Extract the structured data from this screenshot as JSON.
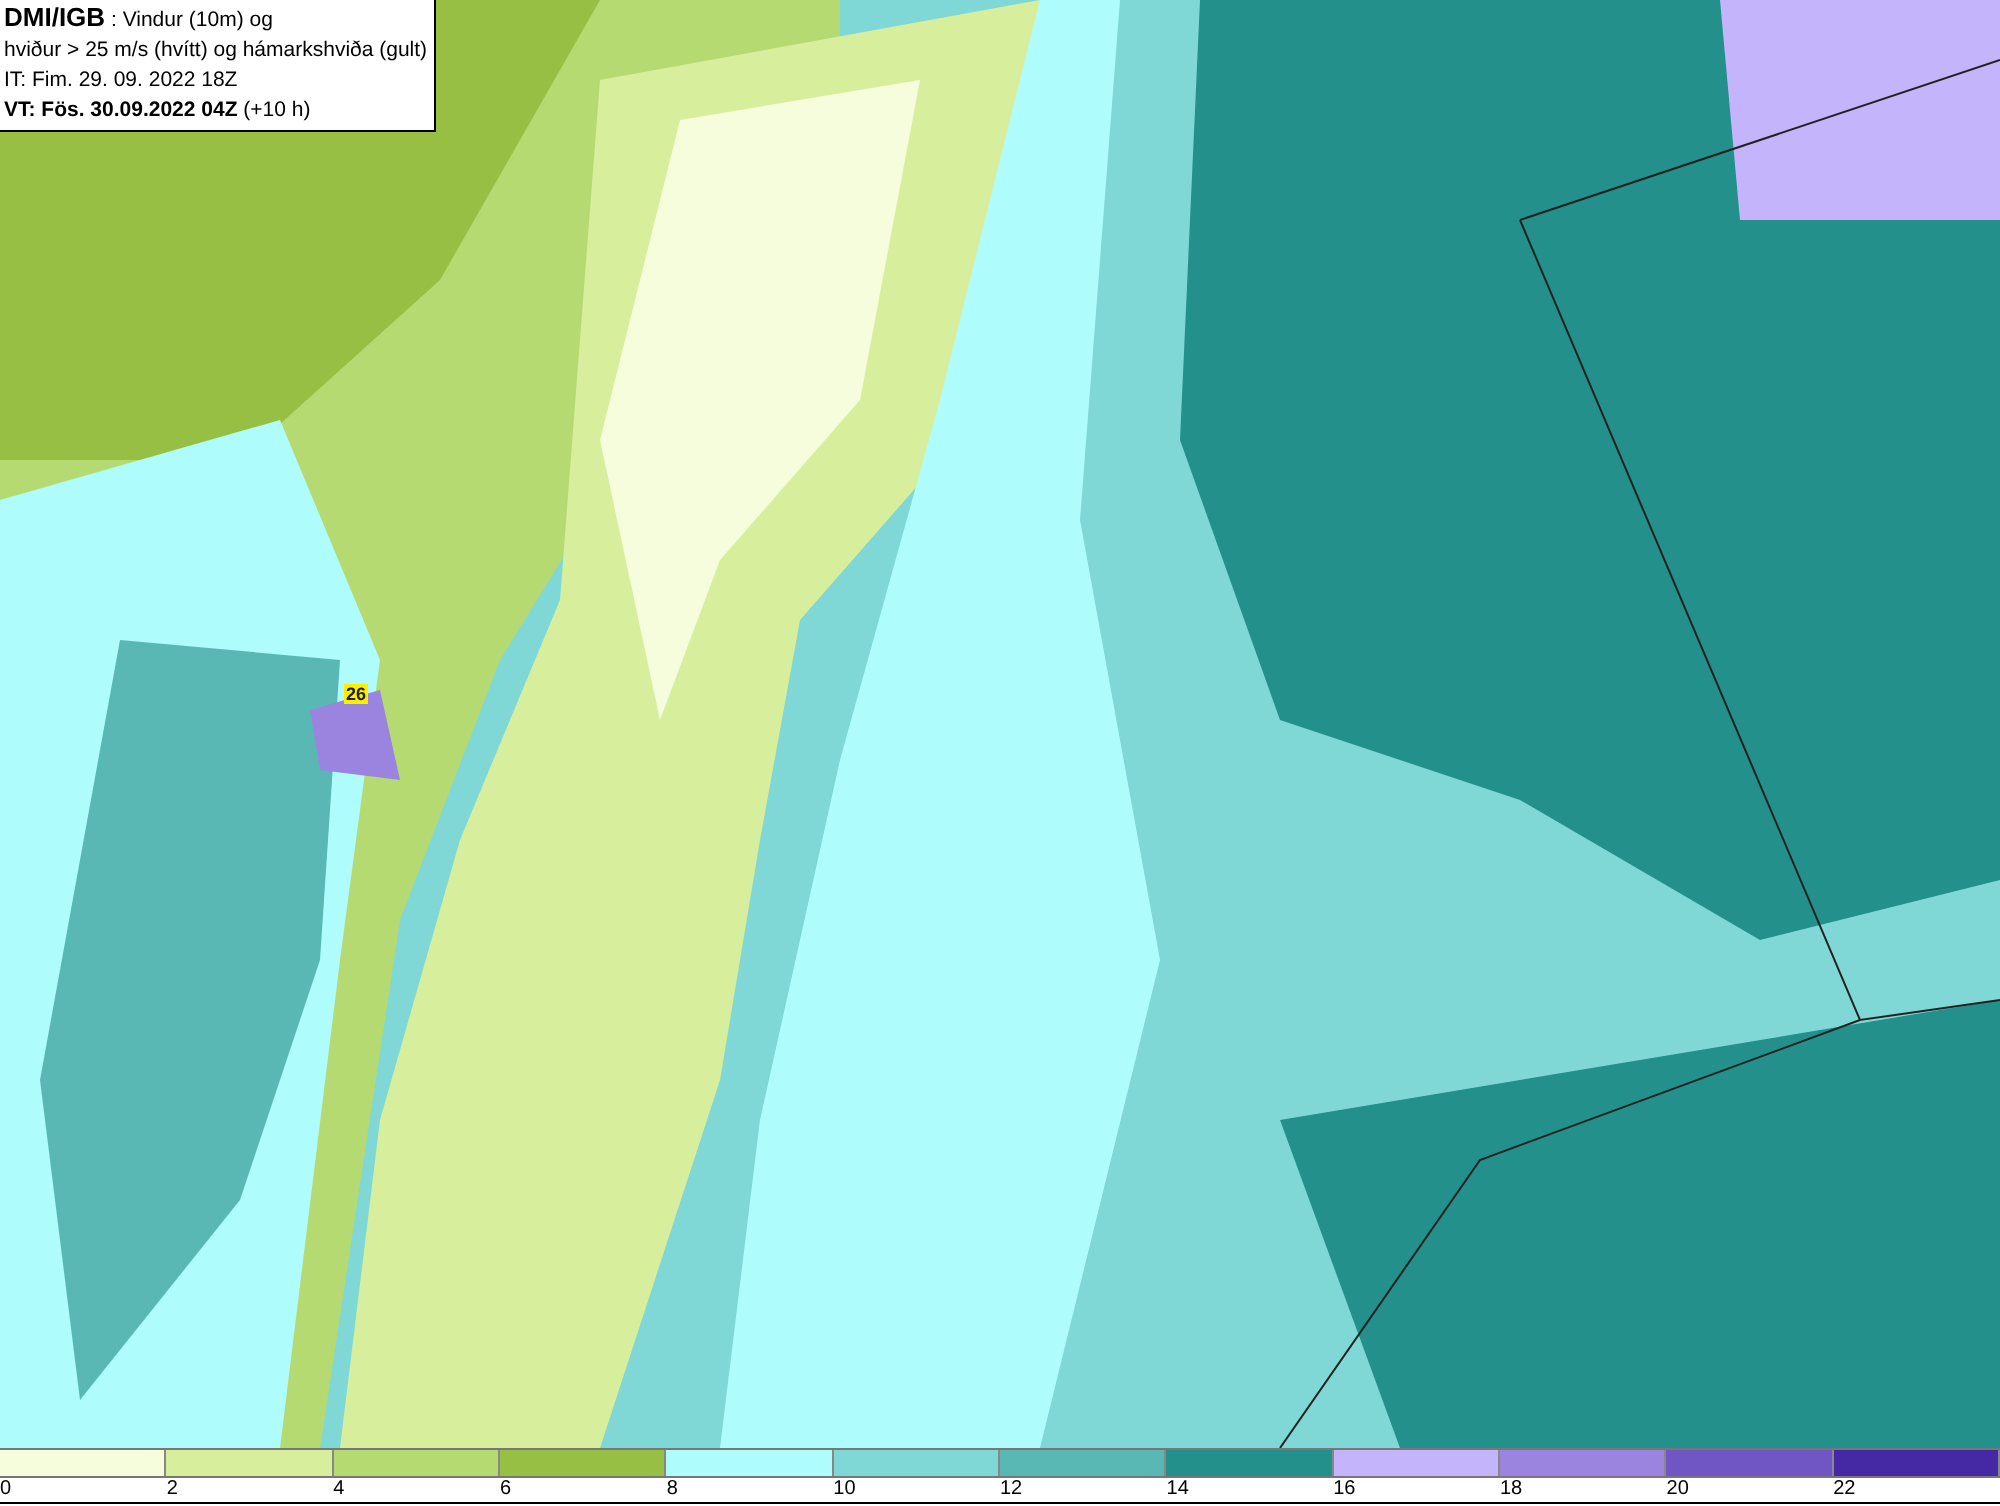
{
  "info_box": {
    "lines": [
      "**DMI/IGB** : Vindur (10m) og",
      "hviður > 25 m/s (hvítt) og hámarkshviða (gult)",
      "IT: Fim. 29. 09. 2022 18Z",
      "**VT: Fös. 30.09.2022 04Z** (+10 h)"
    ]
  },
  "map": {
    "gust_labels": [
      "26"
    ]
  },
  "legend": [
    {
      "label": "0",
      "color": "#f5fddc"
    },
    {
      "label": "2",
      "color": "#d7ef9c"
    },
    {
      "label": "4",
      "color": "#b6da72"
    },
    {
      "label": "6",
      "color": "#97bf44"
    },
    {
      "label": "8",
      "color": "#aefdfc"
    },
    {
      "label": "10",
      "color": "#7fd8d6"
    },
    {
      "label": "12",
      "color": "#59b8b4"
    },
    {
      "label": "14",
      "color": "#24908c"
    },
    {
      "label": "16",
      "color": "#c4b4fc"
    },
    {
      "label": "18",
      "color": "#9b84e0"
    },
    {
      "label": "20",
      "color": "#7056c4"
    },
    {
      "label": "22",
      "color": "#4428a4"
    }
  ]
}
